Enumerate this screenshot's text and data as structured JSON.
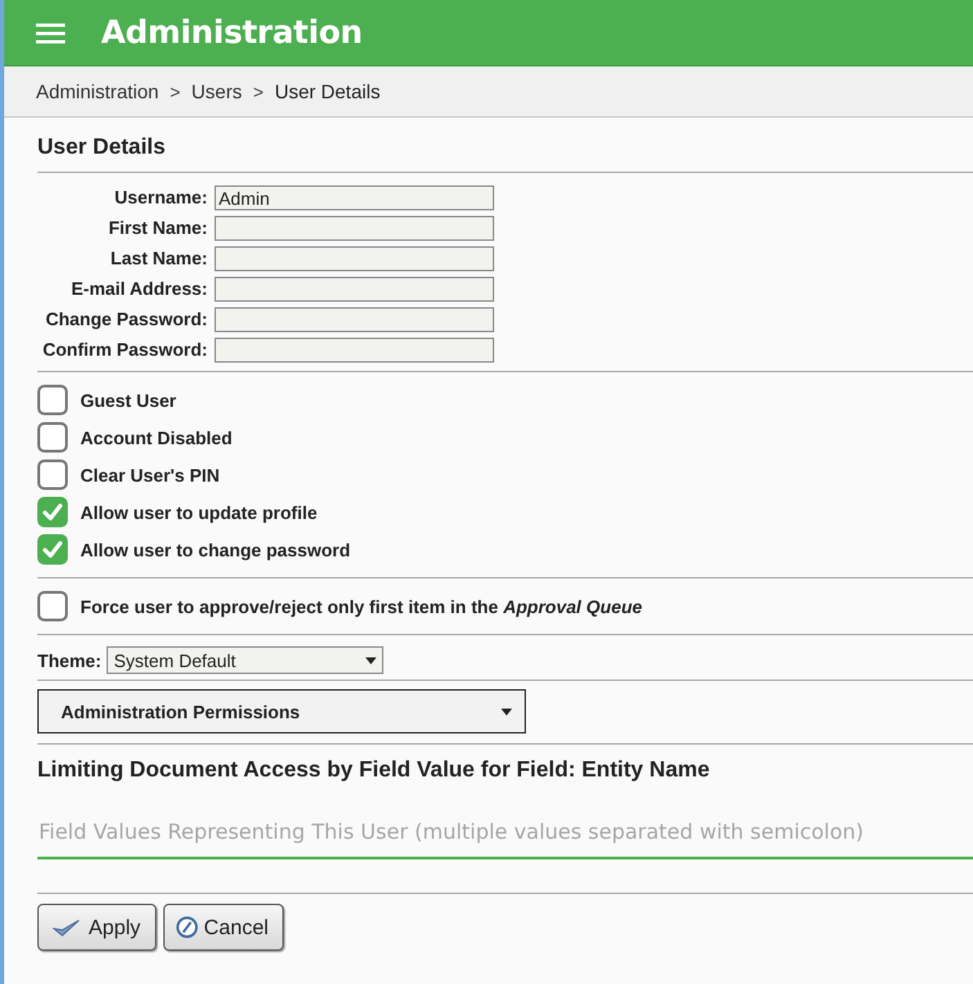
{
  "header": {
    "title": "Administration"
  },
  "breadcrumb": [
    {
      "kind": "link",
      "text": "Administration"
    },
    {
      "kind": "separator",
      "text": ">"
    },
    {
      "kind": "link",
      "text": "Users"
    },
    {
      "kind": "separator",
      "text": ">"
    },
    {
      "kind": "current",
      "text": "User Details"
    }
  ],
  "section_title": "User Details",
  "fields": [
    {
      "label": "Username:",
      "value": "Admin"
    },
    {
      "label": "First Name:"
    },
    {
      "label": "Last Name:"
    },
    {
      "label": "E-mail Address:"
    },
    {
      "label": "Change Password:"
    },
    {
      "label": "Confirm Password:"
    }
  ],
  "options": [
    {
      "label": "Guest User",
      "checked": false
    },
    {
      "label": "Account Disabled",
      "checked": false
    },
    {
      "label": "Clear User's PIN",
      "checked": false
    },
    {
      "label": "Allow user to update profile",
      "checked": true
    },
    {
      "label": "Allow user to change password",
      "checked": true
    }
  ],
  "approval_option": {
    "label": "Force user to approve/reject only first item in the *Approval Queue*",
    "checked": false
  },
  "theme": {
    "label": "Theme:",
    "value": "System Default"
  },
  "permissions_dropdown": {
    "label": "Administration Permissions"
  },
  "limiting": {
    "title": "Limiting Document Access by Field Value for Field: Entity Name",
    "placeholder": "Field Values Representing This User (multiple values separated with semicolon)"
  },
  "buttons": [
    {
      "kind": "apply",
      "label": "Apply"
    },
    {
      "kind": "cancel",
      "label": "Cancel"
    }
  ]
}
